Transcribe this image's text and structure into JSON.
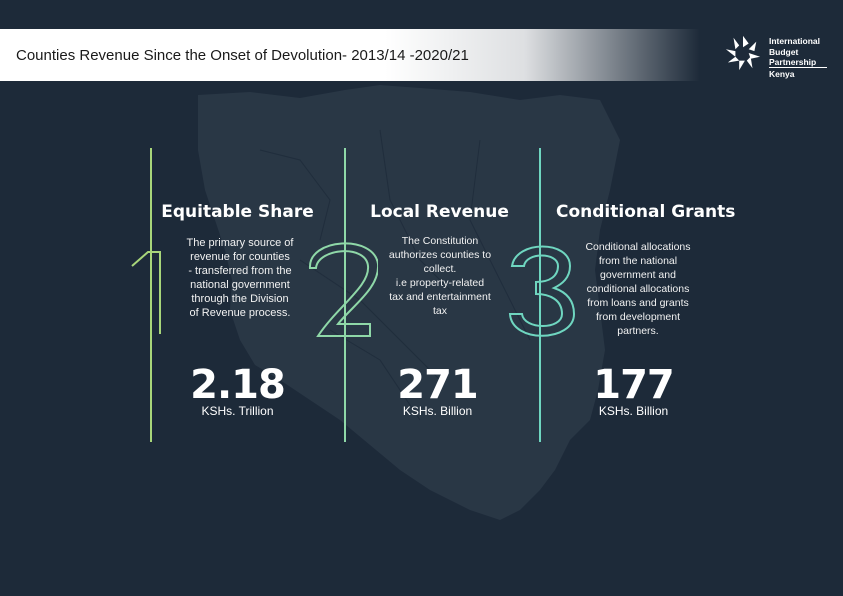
{
  "header": {
    "title": "Counties Revenue Since the Onset of Devolution- 2013/14 -2020/21"
  },
  "logo": {
    "line1": "International",
    "line2": "Budget",
    "line3": "Partnership",
    "country": "Kenya"
  },
  "colors": {
    "background": "#1d2a39",
    "map": "#2b3947",
    "accent_green": "#a8d67a",
    "accent_teal": "#6fd6c0"
  },
  "columns": [
    {
      "number": "1",
      "title": "Equitable Share",
      "description": [
        "The primary source of",
        "revenue for counties",
        "- transferred from the",
        "national government",
        "through the Division",
        "of Revenue process."
      ],
      "value": "2.18",
      "unit": "KSHs. Trillion"
    },
    {
      "number": "2",
      "title": "Local Revenue",
      "description": [
        "The Constitution",
        "authorizes counties to",
        "collect.",
        "i.e property-related",
        "tax and entertainment",
        "tax"
      ],
      "value": "271",
      "unit": "KSHs. Billion"
    },
    {
      "number": "3",
      "title": "Conditional Grants",
      "description": [
        "Conditional allocations",
        "from the national",
        "government and",
        "conditional allocations",
        "from loans and grants",
        "from development",
        "partners."
      ],
      "value": "177",
      "unit": "KSHs. Billion"
    }
  ]
}
